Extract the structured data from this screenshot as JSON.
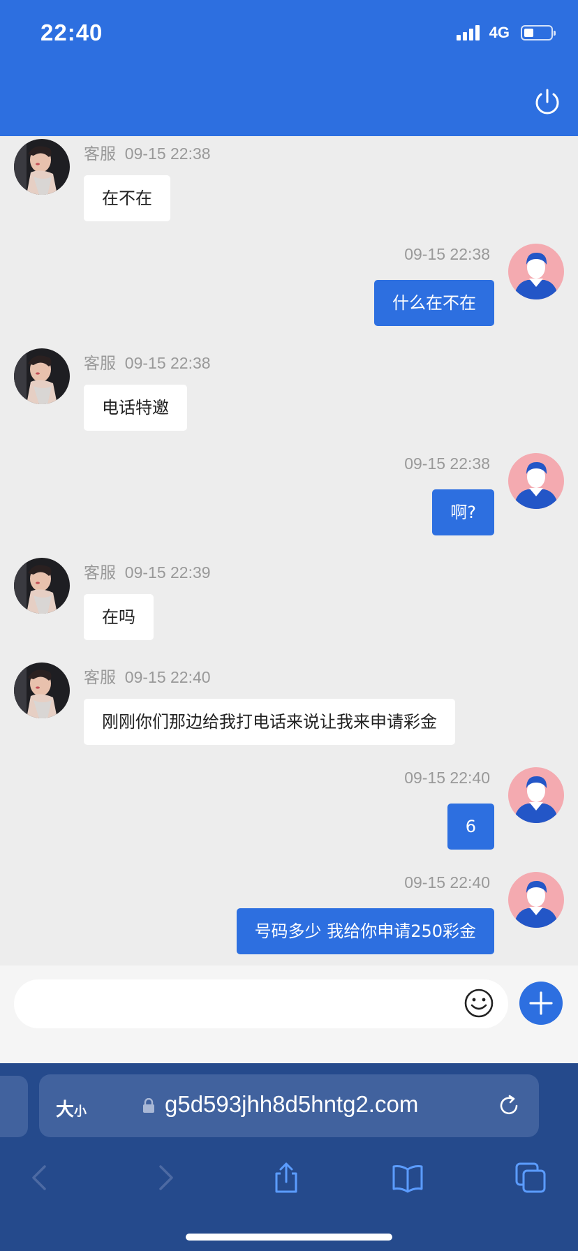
{
  "status_bar": {
    "time": "22:40",
    "network": "4G",
    "battery_percent": 35
  },
  "header": {
    "power_icon": "power-icon"
  },
  "messages": [
    {
      "side": "left",
      "sender": "客服",
      "time": "09-15 22:38",
      "text": "在不在"
    },
    {
      "side": "right",
      "sender": "",
      "time": "09-15 22:38",
      "text": "什么在不在"
    },
    {
      "side": "left",
      "sender": "客服",
      "time": "09-15 22:38",
      "text": "电话特邀"
    },
    {
      "side": "right",
      "sender": "",
      "time": "09-15 22:38",
      "text": "啊?"
    },
    {
      "side": "left",
      "sender": "客服",
      "time": "09-15 22:39",
      "text": "在吗"
    },
    {
      "side": "left",
      "sender": "客服",
      "time": "09-15 22:40",
      "text": "刚刚你们那边给我打电话来说让我来申请彩金"
    },
    {
      "side": "right",
      "sender": "",
      "time": "09-15 22:40",
      "text": "6"
    },
    {
      "side": "right",
      "sender": "",
      "time": "09-15 22:40",
      "text": "号码多少 我给你申请250彩金"
    }
  ],
  "input": {
    "value": "",
    "placeholder": ""
  },
  "browser": {
    "text_size_big": "大",
    "text_size_small": "小",
    "url": "g5d593jhh8d5hntg2.com"
  },
  "colors": {
    "primary": "#2d6fe0",
    "chat_bg": "#ededed",
    "browser_bg": "#254a8c"
  }
}
